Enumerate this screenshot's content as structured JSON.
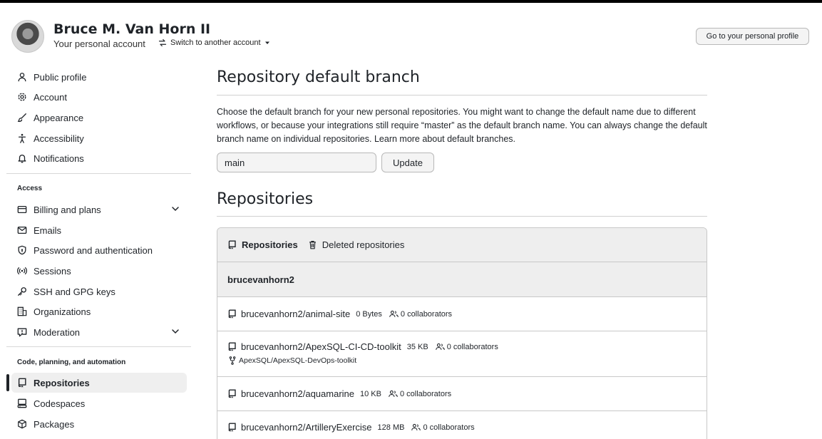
{
  "header": {
    "name": "Bruce M. Van Horn II",
    "subtitle": "Your personal account",
    "switch_label": "Switch to another account",
    "profile_button": "Go to your personal profile"
  },
  "sidebar": {
    "items": [
      {
        "label": "Public profile",
        "icon": "person-icon"
      },
      {
        "label": "Account",
        "icon": "gear-icon"
      },
      {
        "label": "Appearance",
        "icon": "paintbrush-icon"
      },
      {
        "label": "Accessibility",
        "icon": "accessibility-icon"
      },
      {
        "label": "Notifications",
        "icon": "bell-icon"
      }
    ],
    "access_heading": "Access",
    "access_items": [
      {
        "label": "Billing and plans",
        "icon": "credit-card-icon"
      },
      {
        "label": "Emails",
        "icon": "mail-icon"
      },
      {
        "label": "Password and authentication",
        "icon": "shield-lock-icon"
      },
      {
        "label": "Sessions",
        "icon": "broadcast-icon"
      },
      {
        "label": "SSH and GPG keys",
        "icon": "key-icon"
      },
      {
        "label": "Organizations",
        "icon": "organization-icon"
      },
      {
        "label": "Moderation",
        "icon": "report-icon"
      }
    ],
    "code_heading": "Code, planning, and automation",
    "code_items": [
      {
        "label": "Repositories",
        "icon": "repo-icon"
      },
      {
        "label": "Codespaces",
        "icon": "codespaces-icon"
      },
      {
        "label": "Packages",
        "icon": "package-icon"
      }
    ]
  },
  "default_branch": {
    "title": "Repository default branch",
    "description": "Choose the default branch for your new personal repositories. You might want to change the default name due to different workflows, or because your integrations still require “master” as the default branch name. You can always change the default branch name on individual repositories. Learn more about default branches.",
    "input_value": "main",
    "update_button": "Update"
  },
  "repositories": {
    "title": "Repositories",
    "tab_repositories": "Repositories",
    "tab_deleted": "Deleted repositories",
    "owner": "brucevanhorn2",
    "list": [
      {
        "name": "brucevanhorn2/animal-site",
        "size": "0 Bytes",
        "collaborators": "0 collaborators"
      },
      {
        "name": "brucevanhorn2/ApexSQL-CI-CD-toolkit",
        "size": "35 KB",
        "collaborators": "0 collaborators",
        "fork_of": "ApexSQL/ApexSQL-DevOps-toolkit"
      },
      {
        "name": "brucevanhorn2/aquamarine",
        "size": "10 KB",
        "collaborators": "0 collaborators"
      },
      {
        "name": "brucevanhorn2/ArtilleryExercise",
        "size": "128 MB",
        "collaborators": "0 collaborators"
      }
    ]
  }
}
